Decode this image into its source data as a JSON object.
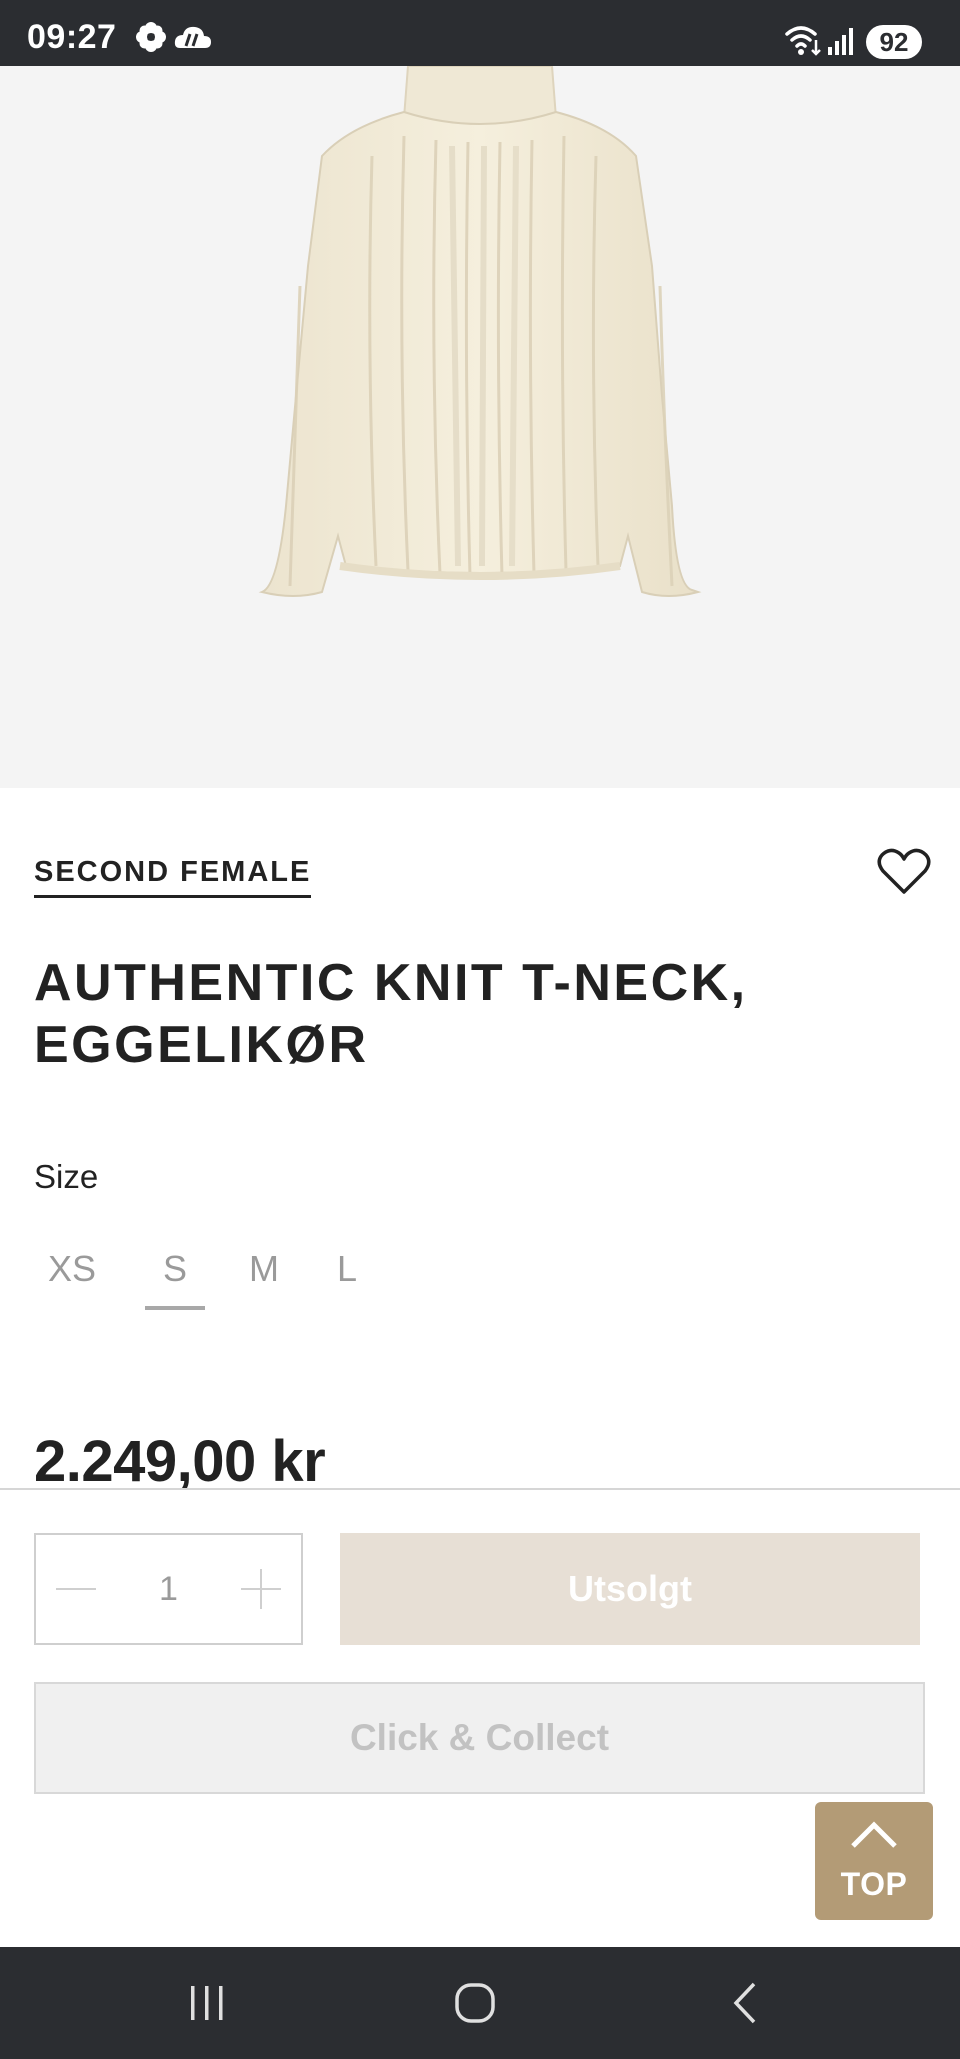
{
  "status_bar": {
    "time": "09:27",
    "battery": "92",
    "icons": [
      "flower-icon",
      "weather-icon",
      "wifi-icon",
      "signal-icon"
    ]
  },
  "product": {
    "image": "cream-knit-sweater-image",
    "brand": "SECOND FEMALE",
    "title_line1": "AUTHENTIC KNIT T-NECK,",
    "title_line2": "EGGELIKØR",
    "size_label": "Size",
    "sizes": [
      "XS",
      "S",
      "M",
      "L"
    ],
    "selected_size": "S",
    "price": "2.249,00 kr"
  },
  "purchase": {
    "quantity": "1",
    "soldout_label": "Utsolgt",
    "click_collect_label": "Click & Collect"
  },
  "top_button": {
    "label": "TOP"
  },
  "colors": {
    "accent": "#b39b76",
    "soldout_bg": "#e7dfd5",
    "system_bar": "#2b2d31"
  }
}
